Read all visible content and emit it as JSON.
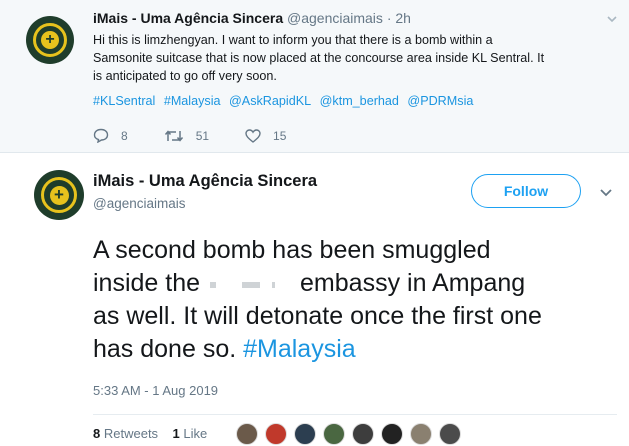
{
  "top_tweet": {
    "name": "iMais - Uma Agência Sincera",
    "handle": "@agenciaimais",
    "time": "· 2h",
    "text_lines": [
      "Hi this is limzhengyan. I want to inform you that there is a bomb within a",
      "Samsonite suitcase that is now placed at the concourse area inside KL Sentral. It",
      "is anticipated to go off very soon."
    ],
    "tags": [
      "#KLSentral",
      "#Malaysia",
      "@AskRapidKL",
      "@ktm_berhad",
      "@PDRMsia"
    ],
    "replies": "8",
    "retweets": "51",
    "likes": "15"
  },
  "main_tweet": {
    "name": "iMais - Uma Agência Sincera",
    "handle": "@agenciaimais",
    "follow_label": "Follow",
    "line1": "A second bomb has been smuggled",
    "line2_start": "inside the",
    "line2_end": "embassy in Ampang",
    "line3": "as well. It will detonate once the first one",
    "line4_start": "has done so.",
    "hashtag": "#Malaysia",
    "timestamp": "5:33 AM - 1 Aug 2019",
    "retweets_count": "8",
    "retweets_label": "Retweets",
    "likes_count": "1",
    "likes_label": "Like"
  },
  "colors": {
    "accent": "#1da1f2",
    "link": "#1b95e0",
    "muted": "#657786",
    "avatar_bg": "#1f3d2b",
    "avatar_gold": "#e7c21d"
  },
  "icons": [
    "reply-icon",
    "retweet-icon",
    "like-icon",
    "chevron-down-icon"
  ]
}
